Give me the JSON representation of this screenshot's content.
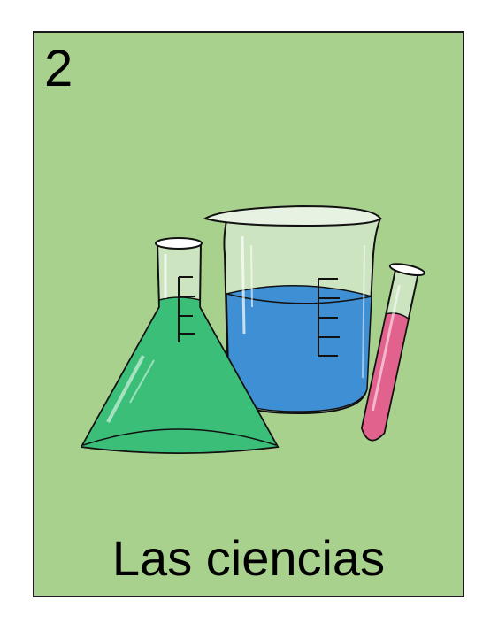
{
  "card": {
    "number": "2",
    "title": "Las ciencias",
    "background_color": "#a9d18e"
  },
  "illustration": {
    "items": [
      "erlenmeyer-flask-icon",
      "beaker-icon",
      "test-tube-icon"
    ],
    "colors": {
      "flask_liquid": "#3bbf78",
      "beaker_liquid": "#3f8fd4",
      "test_tube_liquid": "#e2628e",
      "glass": "#d8ead0"
    }
  }
}
